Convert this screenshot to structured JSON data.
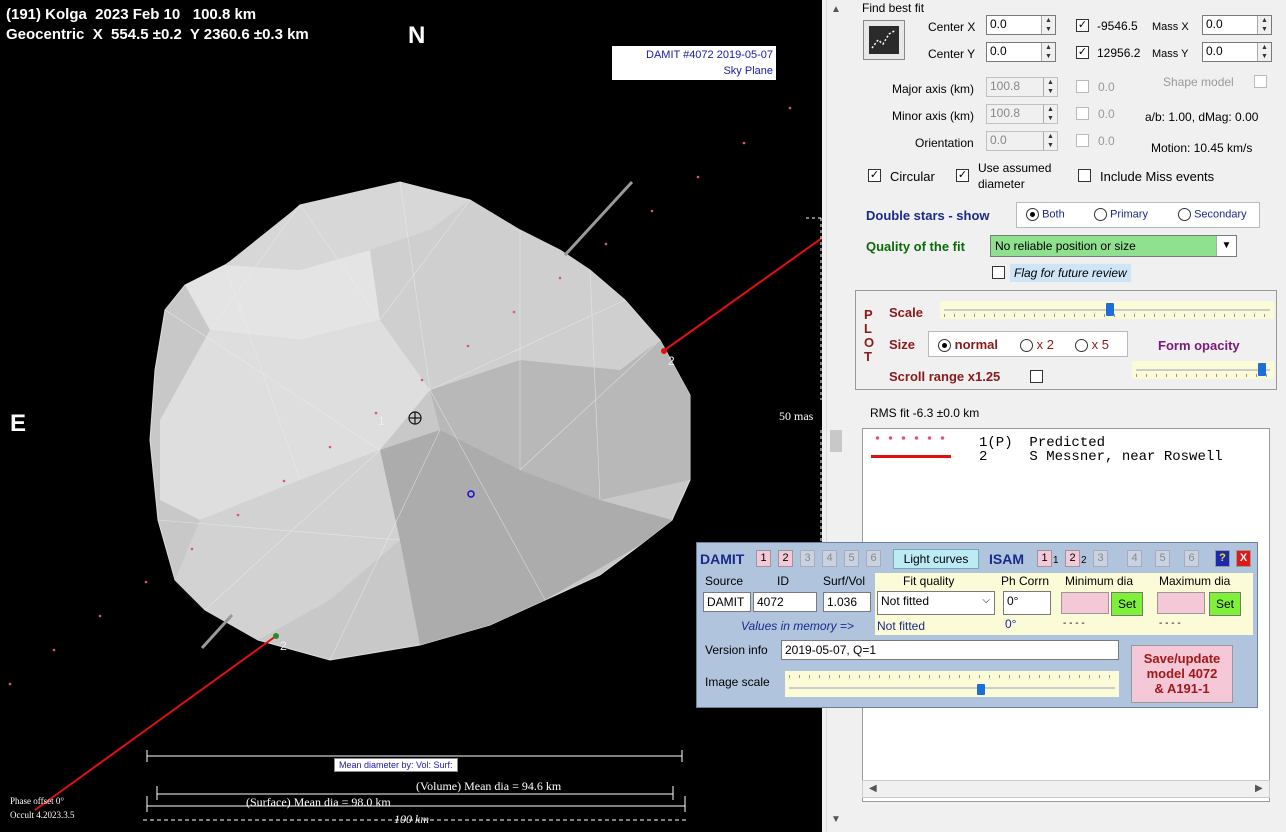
{
  "plot": {
    "title_line1": "(191) Kolga  2023 Feb 10   100.8 km",
    "title_line2": "Geocentric  X  554.5 ±0.2  Y 2360.6 ±0.3 km",
    "north": "N",
    "east": "E",
    "damit_line1": "DAMIT #4072 2019-05-07",
    "damit_line2": "Sky Plane",
    "mas_label": "50 mas",
    "chord_1": "1",
    "chord_2a": "2",
    "chord_2b": "2",
    "mean_dia_by": "Mean diameter by:  Vol:  Surf:",
    "volume_mean": "(Volume) Mean dia = 94.6 km",
    "surface_mean": "(Surface) Mean dia = 98.0 km",
    "scale_100km": "100 km",
    "phase_offset": "Phase offset 0°",
    "occult_version": "Occult 4.2023.3.5"
  },
  "fit": {
    "find_best_fit": "Find best fit",
    "center_x_label": "Center X",
    "center_x": "0.0",
    "center_y_label": "Center Y",
    "center_y": "0.0",
    "cx_check_val": "-9546.5",
    "cy_check_val": "12956.2",
    "mass_x_label": "Mass X",
    "mass_x": "0.0",
    "mass_y_label": "Mass Y",
    "mass_y": "0.0",
    "major_label": "Major axis (km)",
    "major": "100.8",
    "minor_label": "Minor axis (km)",
    "minor": "100.8",
    "orient_label": "Orientation",
    "orient": "0.0",
    "major_zero": "0.0",
    "minor_zero": "0.0",
    "orient_zero": "0.0",
    "shape_model": "Shape model",
    "ab_dmag": "a/b: 1.00, dMag: 0.00",
    "motion": "Motion: 10.45 km/s",
    "circular": "Circular",
    "use_assumed_1": "Use assumed",
    "use_assumed_2": "diameter",
    "include_miss": "Include Miss events",
    "double_stars": "Double stars - show",
    "ds_both": "Both",
    "ds_primary": "Primary",
    "ds_secondary": "Secondary",
    "quality_label": "Quality of the fit",
    "quality_value": "No reliable position or size",
    "flag_review": "Flag for future review"
  },
  "plotbox": {
    "plot_letters": [
      "P",
      "L",
      "O",
      "T"
    ],
    "scale": "Scale",
    "size": "Size",
    "normal": "normal",
    "x2": "x 2",
    "x5": "x 5",
    "form_opacity": "Form opacity",
    "scroll_range": "Scroll range x1.25"
  },
  "rms": "RMS fit -6.3 ±0.0 km",
  "legend": [
    {
      "id": "1(P)",
      "name": "Predicted"
    },
    {
      "id": "2",
      "name": "S Messner, near Roswell"
    }
  ],
  "damit": {
    "title": "DAMIT",
    "nums": [
      "1",
      "2",
      "3",
      "4",
      "5",
      "6"
    ],
    "light_curves": "Light curves",
    "isam": "ISAM",
    "isam_nums": [
      "1",
      "1",
      "2",
      "2",
      "3",
      "4",
      "5",
      "6"
    ],
    "help": "?",
    "close": "X",
    "source_label": "Source",
    "id_label": "ID",
    "surf_vol_label": "Surf/Vol",
    "source": "DAMIT",
    "id": "4072",
    "surf_vol": "1.036",
    "fit_quality_label": "Fit quality",
    "fit_quality": "Not fitted",
    "fit_quality_mem": "Not fitted",
    "ph_corrn_label": "Ph Corrn",
    "ph_corrn": "0°",
    "ph_corrn_mem": "0°",
    "min_dia_label": "Minimum dia",
    "max_dia_label": "Maximum dia",
    "min_mem": "- - - -",
    "max_mem": "- - - -",
    "set": "Set",
    "values_in_memory": "Values in memory =>",
    "version_label": "Version info",
    "version": "2019-05-07, Q=1",
    "image_scale": "Image scale",
    "save_line1": "Save/update",
    "save_line2": "model 4072",
    "save_line3": "& A191-1"
  }
}
